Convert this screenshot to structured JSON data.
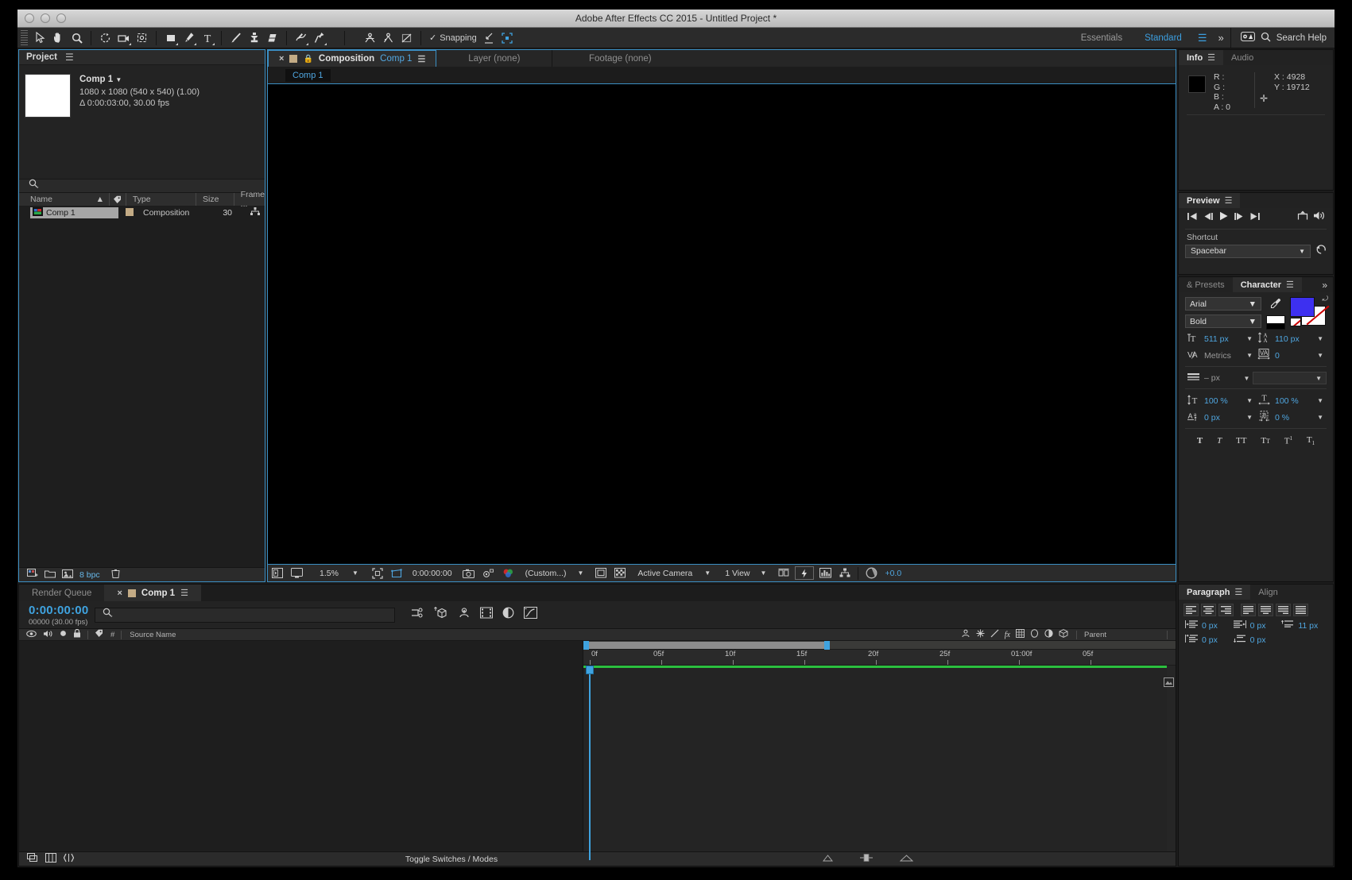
{
  "window": {
    "title": "Adobe After Effects CC 2015 - Untitled Project *"
  },
  "toolbar": {
    "snapping_label": "Snapping",
    "snapping_check": "✓",
    "tools": [
      {
        "name": "selection-tool"
      },
      {
        "name": "hand-tool"
      },
      {
        "name": "zoom-tool"
      },
      {
        "name": "rotation-tool"
      },
      {
        "name": "camera-tool"
      },
      {
        "name": "pan-behind-tool"
      },
      {
        "name": "shape-tool"
      },
      {
        "name": "pen-tool"
      },
      {
        "name": "text-tool"
      },
      {
        "name": "brush-tool"
      },
      {
        "name": "clone-stamp-tool"
      },
      {
        "name": "eraser-tool"
      },
      {
        "name": "roto-brush-tool"
      },
      {
        "name": "puppet-pin-tool"
      }
    ]
  },
  "workspace": {
    "essentials": "Essentials",
    "standard": "Standard",
    "menu_glyph": "☰",
    "chevrons": "»",
    "search_help": "Search Help"
  },
  "project": {
    "title": "Project",
    "menu_glyph": "☰",
    "item": {
      "name": "Comp 1",
      "dimensions": "1080 x 1080  (540 x 540) (1.00)",
      "duration": "Δ 0:00:03:00, 30.00 fps"
    },
    "columns": [
      "Name",
      "Type",
      "Size",
      "Frame ..."
    ],
    "rows": [
      {
        "name": "Comp 1",
        "type": "Composition",
        "size": "30"
      }
    ],
    "bit_depth": "8 bpc"
  },
  "composition": {
    "tabs": [
      {
        "label": "Composition",
        "comp_name": "Comp 1",
        "active": true
      },
      {
        "label": "Layer (none)",
        "active": false
      },
      {
        "label": "Footage (none)",
        "active": false
      }
    ],
    "breadcrumb": "Comp 1",
    "bottom_bar": {
      "magnification": "1.5%",
      "timecode": "0:00:00:00",
      "resolution": "(Custom...)",
      "camera": "Active Camera",
      "views": "1 View",
      "exposure": "+0.0"
    }
  },
  "info": {
    "tabs": [
      "Info",
      "Audio"
    ],
    "menu_glyph": "☰",
    "channels": [
      "R :",
      "G :",
      "B :",
      "A : 0"
    ],
    "x_label": "X :",
    "x_value": "4928",
    "y_label": "Y :",
    "y_value": "19712"
  },
  "preview": {
    "title": "Preview",
    "menu_glyph": "☰",
    "shortcut_label": "Shortcut",
    "shortcut_value": "Spacebar"
  },
  "character": {
    "tabs": [
      {
        "label": "& Presets",
        "active": false
      },
      {
        "label": "Character",
        "active": true
      }
    ],
    "menu_glyph": "☰",
    "chevrons": "»",
    "font_family": "Arial",
    "font_style": "Bold",
    "font_size": "511 px",
    "leading": "110 px",
    "kerning": "Metrics",
    "tracking": "0",
    "stroke_width": "– px",
    "vertical_scale": "100 %",
    "horizontal_scale": "100 %",
    "baseline_shift": "0 px",
    "tsume": "0 %",
    "fill_color": "#3d30f0",
    "stroke_color": "#ffffff",
    "styles": [
      "T",
      "T",
      "TT",
      "TT",
      "T¹",
      "T₁"
    ]
  },
  "paragraph": {
    "tabs": [
      {
        "label": "Paragraph",
        "active": true
      },
      {
        "label": "Align",
        "active": false
      }
    ],
    "menu_glyph": "☰",
    "indent_left": "0 px",
    "indent_right": "0 px",
    "space_before": "11 px",
    "first_line_indent": "0 px",
    "space_after": "0 px"
  },
  "timeline": {
    "tabs": [
      {
        "label": "Render Queue",
        "active": false
      },
      {
        "label": "Comp 1",
        "active": true
      }
    ],
    "menu_glyph": "☰",
    "current_time": "0:00:00:00",
    "frame_info": "00000 (30.00 fps)",
    "search_placeholder": "",
    "columns": [
      "#",
      "Source Name",
      "Parent"
    ],
    "ruler_ticks": [
      "0f",
      "05f",
      "10f",
      "15f",
      "20f",
      "25f",
      "01:00f",
      "05f"
    ],
    "footer_label": "Toggle Switches / Modes"
  },
  "colors": {
    "accent_blue": "#3fa3e0",
    "panel_bg": "#232323",
    "header_bg": "#2b2b2b",
    "canvas_bg": "#000000",
    "work_area_green": "#2bbf3f",
    "comp_swatch": "#c3ab85"
  }
}
